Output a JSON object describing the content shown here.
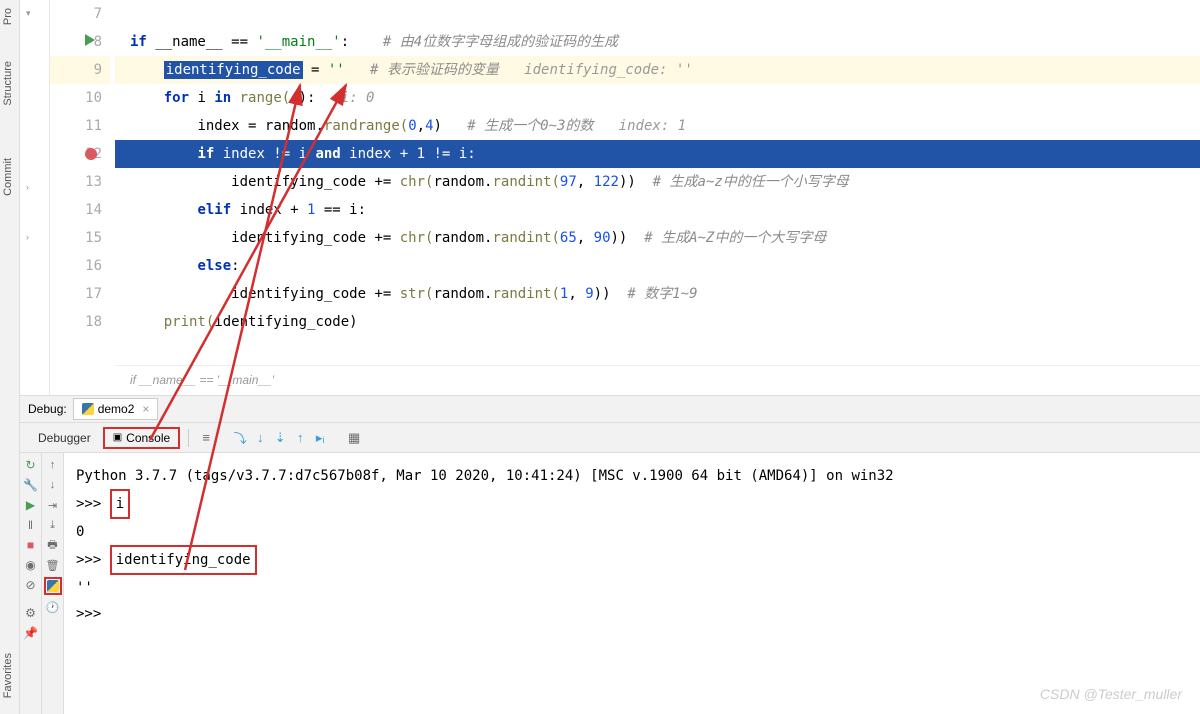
{
  "sidebar": {
    "tools": [
      "Pro",
      "Structure",
      "Commit",
      "Favorites"
    ]
  },
  "gutter": {
    "lines": [
      7,
      8,
      9,
      10,
      11,
      12,
      13,
      14,
      15,
      16,
      17,
      18
    ]
  },
  "code": {
    "l8": {
      "kw1": "if",
      "name": " __name__ ",
      "op": "==",
      "str": " '__main__'",
      "colon": ":",
      "cm": "    # 由4位数字字母组成的验证码的生成"
    },
    "l9": {
      "var": "identifying_code",
      "op": " = ",
      "str": "''",
      "cm": "   # 表示验证码的变量",
      "hint": "   identifying_code: ''"
    },
    "l10": {
      "kw1": "for",
      "id": " i ",
      "kw2": "in",
      "fn": " range(",
      "num": "4",
      "close": "):",
      "hint": "   i: 0"
    },
    "l11": {
      "id": "index",
      "op": " = ",
      "mod": "random.",
      "fn": "randrange(",
      "n1": "0",
      "c": ",",
      "n2": "4",
      "close": ")",
      "cm": "   # 生成一个0~3的数",
      "hint": "   index: 1"
    },
    "l12": {
      "kw1": "if",
      "e1": " index != i ",
      "kw2": "and",
      "e2": " index + ",
      "n": "1",
      "e3": " != i:"
    },
    "l13": {
      "id": "identifying_code ",
      "op": "+=",
      "fn": " chr(",
      "mod": "random.",
      "fn2": "randint(",
      "n1": "97",
      "c": ", ",
      "n2": "122",
      "close": "))",
      "cm": "  # 生成a~z中的任一个小写字母"
    },
    "l14": {
      "kw": "elif",
      "e": " index + ",
      "n": "1",
      "e2": " == i:"
    },
    "l15": {
      "id": "identifying_code ",
      "op": "+=",
      "fn": " chr(",
      "mod": "random.",
      "fn2": "randint(",
      "n1": "65",
      "c": ", ",
      "n2": "90",
      "close": "))",
      "cm": "  # 生成A~Z中的一个大写字母"
    },
    "l16": {
      "kw": "else",
      "colon": ":"
    },
    "l17": {
      "id": "identifying_code ",
      "op": "+=",
      "fn": " str(",
      "mod": "random.",
      "fn2": "randint(",
      "n1": "1",
      "c": ", ",
      "n2": "9",
      "close": "))",
      "cm": "  # 数字1~9"
    },
    "l18": {
      "fn": "print(",
      "id": "identifying_code",
      "close": ")"
    }
  },
  "breadcrumb": "if __name__ == '__main__'",
  "debug": {
    "label": "Debug:",
    "tab": "demo2",
    "debugger_tab": "Debugger",
    "console_tab": "Console"
  },
  "console": {
    "banner": "Python 3.7.7 (tags/v3.7.7:d7c567b08f, Mar 10 2020, 10:41:24) [MSC v.1900 64 bit (AMD64)] on win32",
    "p1": ">>> ",
    "in1": "i",
    "out1": "0",
    "p2": ">>> ",
    "in2": "identifying_code",
    "out2": "''",
    "p3": ">>>"
  },
  "watermark": "CSDN @Tester_muller"
}
